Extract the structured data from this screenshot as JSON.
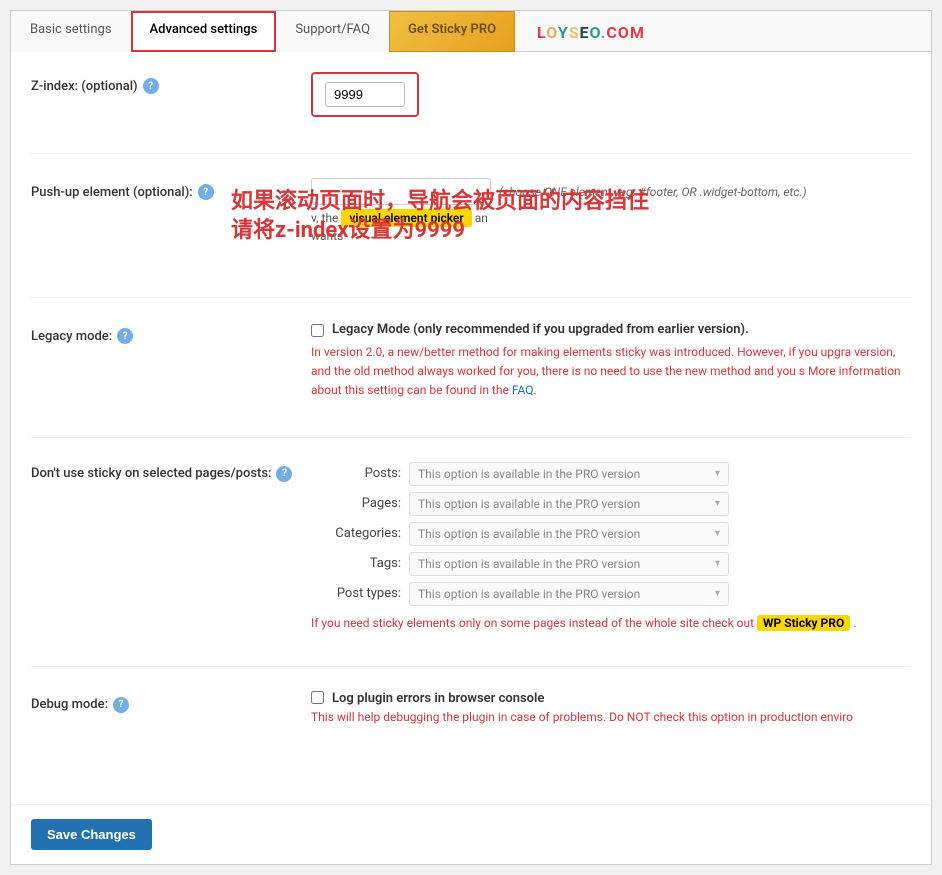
{
  "tabs": [
    {
      "id": "basic",
      "label": "Basic settings",
      "active": false,
      "highlighted": false
    },
    {
      "id": "advanced",
      "label": "Advanced settings",
      "active": true,
      "highlighted": true
    },
    {
      "id": "support",
      "label": "Support/FAQ",
      "active": false,
      "highlighted": false
    },
    {
      "id": "get-pro",
      "label": "Get Sticky PRO",
      "active": false,
      "highlighted": false
    }
  ],
  "loyseo": {
    "brand": "LOYSEO.COM"
  },
  "zindex": {
    "label": "Z-index: (optional)",
    "value": "9999"
  },
  "pushup": {
    "label": "Push-up element (optional):",
    "placeholder": "",
    "hint": "(choose ONE element, e.g. #footer, OR .widget-bottom, etc.)",
    "extra_before": "v, the",
    "extra_mid": " ",
    "visual_picker": "visual element picker",
    "extra_after": " an",
    "wants": "wants"
  },
  "chinese": {
    "line1": "如果滚动页面时，导航会被页面的内容挡住",
    "line2": "请将z-index设置为9999"
  },
  "legacy": {
    "label": "Legacy mode:",
    "checkbox_label": "Legacy Mode (only recommended if you upgraded from earlier version).",
    "description": "In version 2.0, a new/better method for making elements sticky was introduced. However, if you upgra version, and the old method always worked for you, there is no need to use the new method and you s More information about this setting can be found in the",
    "faq_link": "FAQ",
    "faq_url": "#"
  },
  "sticky_pages": {
    "label": "Don't use sticky on selected pages/posts:",
    "rows": [
      {
        "label": "Posts:",
        "pro_text": "This option is available in the PRO version"
      },
      {
        "label": "Pages:",
        "pro_text": "This option is available in the PRO version"
      },
      {
        "label": "Categories:",
        "pro_text": "This option is available in the PRO version"
      },
      {
        "label": "Tags:",
        "pro_text": "This option is available in the PRO version"
      },
      {
        "label": "Post types:",
        "pro_text": "This option is available in the PRO version"
      }
    ],
    "pro_note_before": "If you need sticky elements only on some pages instead of the whole site check out",
    "pro_badge": "WP Sticky PRO",
    "pro_note_after": "."
  },
  "debug": {
    "label": "Debug mode:",
    "checkbox_label": "Log plugin errors in browser console",
    "description": "This will help debugging the plugin in case of problems. Do NOT check this option in production enviro"
  },
  "footer": {
    "save_label": "Save Changes"
  }
}
